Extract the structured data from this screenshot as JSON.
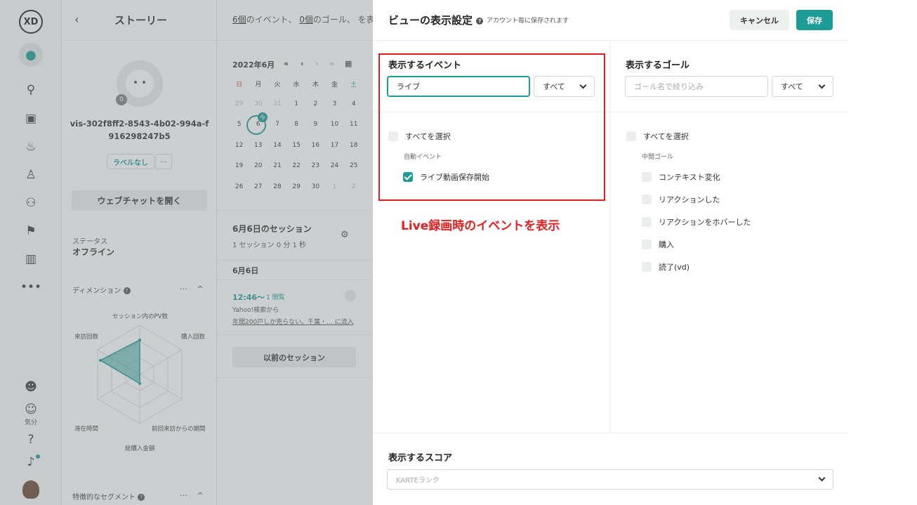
{
  "rail": {
    "logo": "XD",
    "mood_label": "気分"
  },
  "story": {
    "title": "ストーリー",
    "avatar_badge": "0",
    "visitor_id": "vis-302f8ff2-8543-4b02-994a-f916298247b5",
    "label_tag": "ラベルなし",
    "label_more": "···",
    "open_chat": "ウェブチャットを開く",
    "status_label": "ステータス",
    "status_value": "オフライン",
    "dimensions_title": "ディメンション",
    "radar_labels": {
      "top": "セッション内のPV数",
      "top_left": "来訪回数",
      "top_right": "購入回数",
      "bottom_left": "滞在時間",
      "bottom_right": "前回来訪からの期間",
      "bottom": "総購入金額"
    },
    "segment_title": "特徴的なセグメント"
  },
  "timeline": {
    "summary": {
      "event_count": "6個",
      "event_text": "のイベント、",
      "goal_count": "0個",
      "goal_text": "のゴール、 を表示"
    },
    "calendar": {
      "month": "2022年6月",
      "nav": [
        "«",
        "‹",
        "›",
        "»",
        "▦"
      ],
      "weekdays": [
        "日",
        "月",
        "火",
        "水",
        "木",
        "金",
        "土"
      ],
      "days": [
        "29",
        "30",
        "31",
        "1",
        "2",
        "3",
        "4",
        "5",
        "6",
        "7",
        "8",
        "9",
        "10",
        "11",
        "12",
        "13",
        "14",
        "15",
        "16",
        "17",
        "18",
        "19",
        "20",
        "21",
        "22",
        "23",
        "24",
        "25",
        "26",
        "27",
        "28",
        "29",
        "30",
        "1",
        "2"
      ],
      "today_badge": "今"
    },
    "session_title": "6月6日のセッション",
    "session_meta": "1 セッション  0 分 1 秒",
    "date_header": "6月6日",
    "session_time": "12:46〜",
    "session_views": "1 閲覧",
    "session_source": "Yahoo!検索から",
    "session_page": "年間200戸しか売らない。千葉・...  に流入",
    "prev_sessions": "以前のセッション"
  },
  "modal": {
    "title": "ビューの表示設定",
    "subtitle": "アカウント毎に保存されます",
    "cancel": "キャンセル",
    "save": "保存",
    "events": {
      "heading": "表示するイベント",
      "filter_value": "ライブ",
      "filter_scope": "すべて",
      "select_all": "すべてを選択",
      "group": "自動イベント",
      "items": [
        {
          "label": "ライブ動画保存開始",
          "checked": true
        }
      ]
    },
    "goals": {
      "heading": "表示するゴール",
      "filter_placeholder": "ゴール名で絞り込み",
      "filter_scope": "すべて",
      "select_all": "すべてを選択",
      "group": "中間ゴール",
      "items": [
        {
          "label": "コンテキスト変化",
          "checked": false
        },
        {
          "label": "リアクションした",
          "checked": false
        },
        {
          "label": "リアクションをホバーした",
          "checked": false
        },
        {
          "label": "購入",
          "checked": false
        },
        {
          "label": "読了(vd)",
          "checked": false
        }
      ]
    },
    "annotation": "Live録画時のイベントを表示",
    "score": {
      "heading": "表示するスコア",
      "placeholder": "KARTEランク"
    }
  },
  "colors": {
    "accent": "#1d9b97",
    "highlight": "#e02020",
    "sunday": "#d63a3a"
  }
}
